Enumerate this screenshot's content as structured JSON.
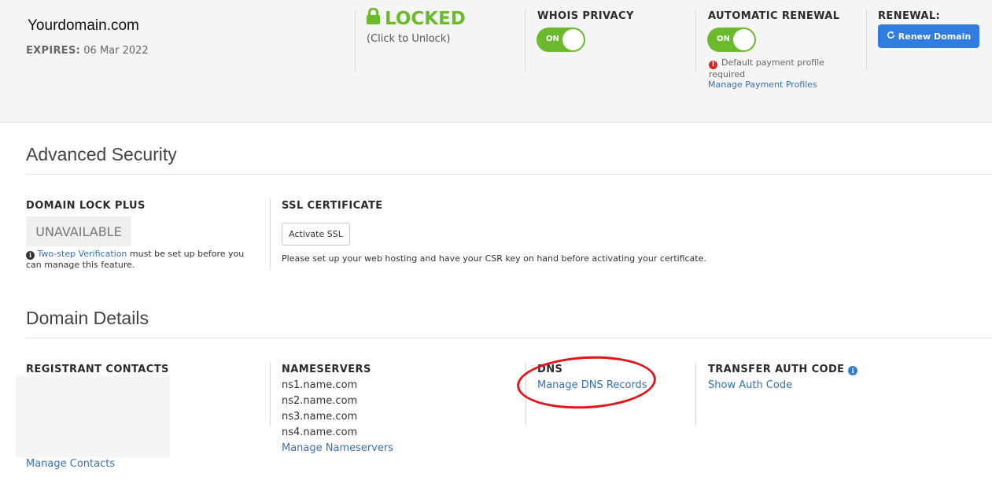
{
  "header": {
    "domain": "Yourdomain.com",
    "expires_label": "EXPIRES:",
    "expires_value": "06 Mar 2022",
    "lock": {
      "status": "LOCKED",
      "hint": "(Click to Unlock)"
    },
    "whois": {
      "title": "WHOIS PRIVACY",
      "toggle": "ON"
    },
    "auto_renewal": {
      "title": "AUTOMATIC RENEWAL",
      "toggle": "ON",
      "warning": "Default payment profile required",
      "link": "Manage Payment Profiles"
    },
    "renewal": {
      "title": "RENEWAL:",
      "button": "Renew Domain"
    }
  },
  "advanced_security": {
    "title": "Advanced Security",
    "domain_lock_plus": {
      "title": "DOMAIN LOCK PLUS",
      "status": "UNAVAILABLE",
      "note_link": "Two-step Verification",
      "note_text": " must be set up before you can manage this feature."
    },
    "ssl": {
      "title": "SSL CERTIFICATE",
      "button": "Activate SSL",
      "note": "Please set up your web hosting and have your CSR key on hand before activating your certificate."
    }
  },
  "domain_details": {
    "title": "Domain Details",
    "registrant": {
      "title": "REGISTRANT CONTACTS",
      "link": "Manage Contacts"
    },
    "nameservers": {
      "title": "NAMESERVERS",
      "items": [
        "ns1.name.com",
        "ns2.name.com",
        "ns3.name.com",
        "ns4.name.com"
      ],
      "link": "Manage Nameservers"
    },
    "dns": {
      "title": "DNS",
      "link": "Manage DNS Records"
    },
    "transfer": {
      "title": "TRANSFER AUTH CODE",
      "link": "Show Auth Code"
    }
  },
  "colors": {
    "accent_green": "#6bba2d",
    "primary_blue": "#2f7de1",
    "link_blue": "#3a6fb0",
    "annotation_red": "#e3151a"
  },
  "icons": [
    "lock-icon",
    "refresh-icon",
    "error-icon",
    "info-icon"
  ]
}
